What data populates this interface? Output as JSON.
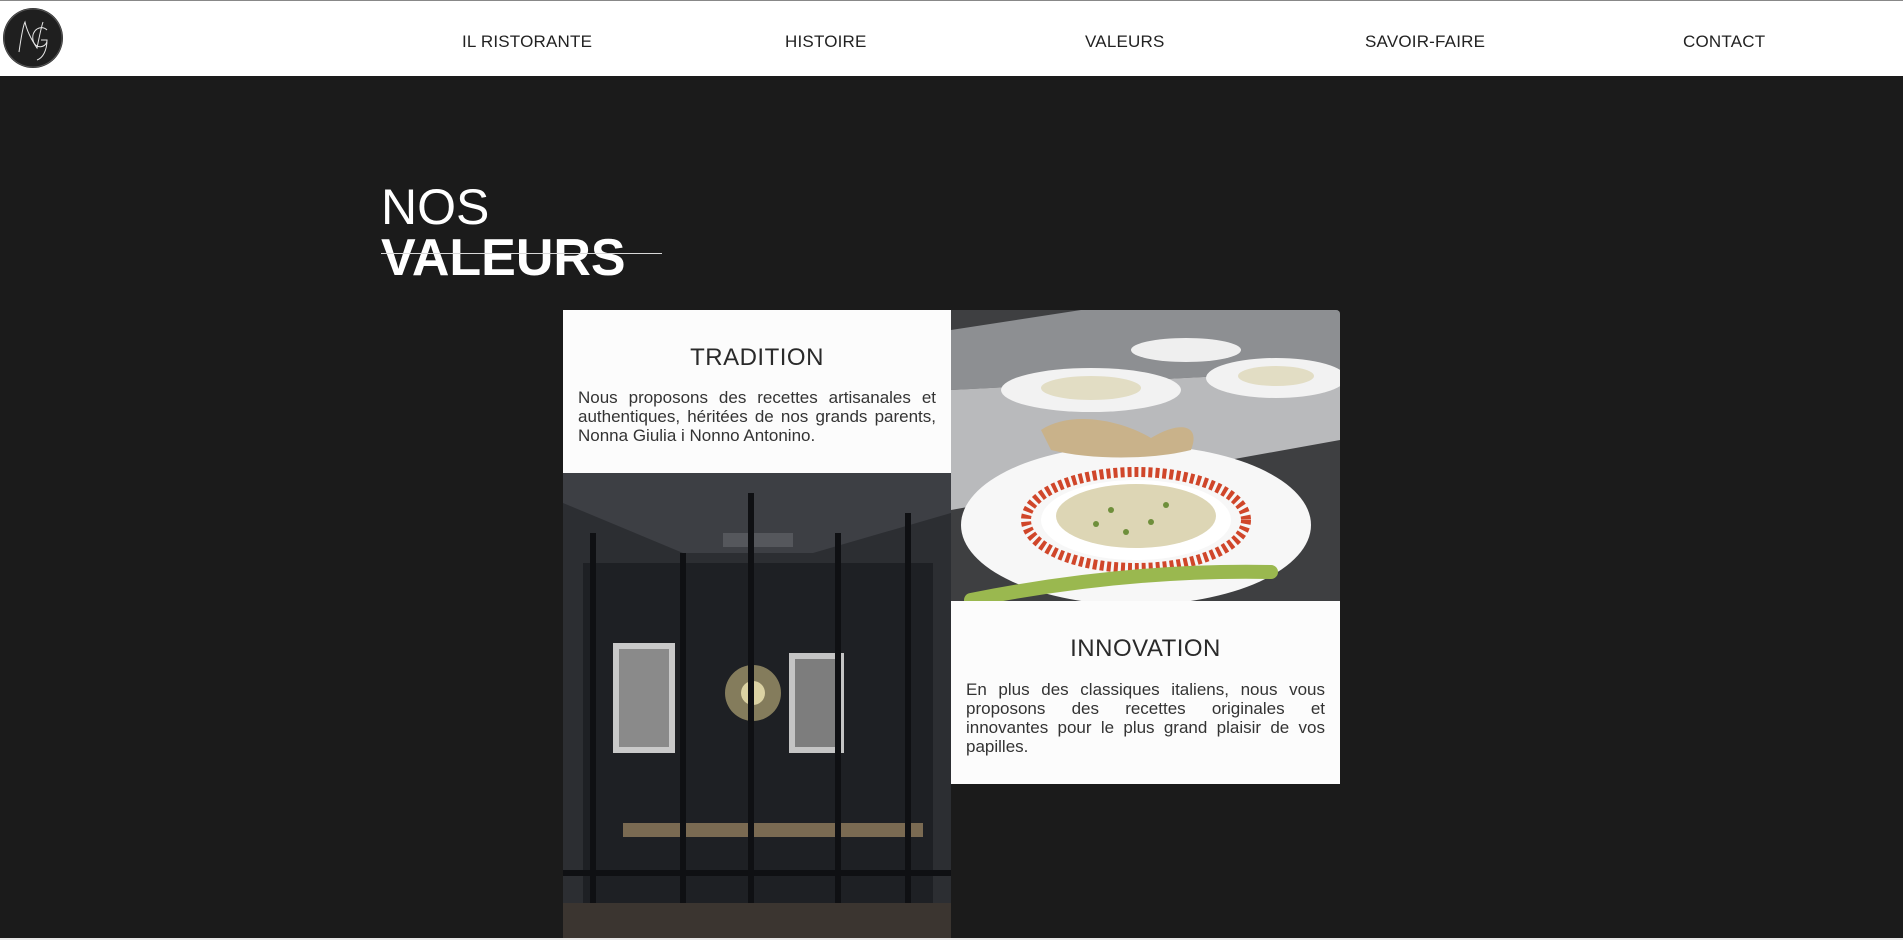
{
  "nav": {
    "logo_text": "NG",
    "items": [
      "IL RISTORANTE",
      "HISTOIRE",
      "VALEURS",
      "SAVOIR-FAIRE",
      "CONTACT"
    ]
  },
  "section": {
    "title_line1": "NOS",
    "title_line2": "VALEURS"
  },
  "tradition": {
    "title": "TRADITION",
    "text": "Nous proposons des recettes artisanales et authentiques, héritées de nos grands parents, Nonna Giulia i Nonno Antonino."
  },
  "innovation": {
    "title": "INNOVATION",
    "text": "En plus des classiques italiens, nous vous proposons des recettes originales et innovantes pour le plus grand plaisir de vos papilles."
  },
  "colors": {
    "background": "#1b1b1b",
    "header": "#ffffff",
    "card": "#fcfcfc",
    "text_dark": "#2a2a2a"
  },
  "icons": [
    "logo-monogram"
  ]
}
